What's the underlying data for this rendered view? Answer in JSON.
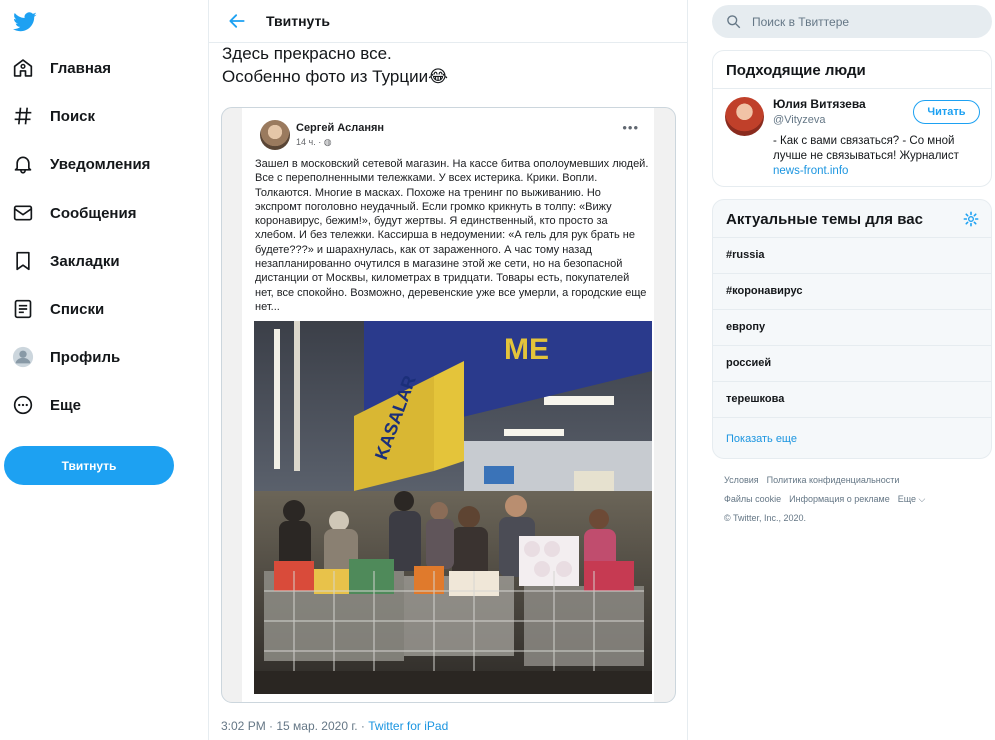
{
  "nav": {
    "items": [
      {
        "label": "Главная",
        "icon": "home-icon"
      },
      {
        "label": "Поиск",
        "icon": "hashtag-icon"
      },
      {
        "label": "Уведомления",
        "icon": "bell-icon"
      },
      {
        "label": "Сообщения",
        "icon": "mail-icon"
      },
      {
        "label": "Закладки",
        "icon": "bookmark-icon"
      },
      {
        "label": "Списки",
        "icon": "list-icon"
      },
      {
        "label": "Профиль",
        "icon": "profile-avatar"
      },
      {
        "label": "Еще",
        "icon": "more-icon"
      }
    ],
    "tweet_button": "Твитнуть"
  },
  "header": {
    "title": "Твитнуть"
  },
  "tweet": {
    "text_line1": "Здесь прекрасно все.",
    "text_line2": "Особенно фото из Турции",
    "emoji": "😂",
    "embedded_post": {
      "author": "Сергей Асланян",
      "time": "14 ч. ·",
      "body": "Зашел в московский сетевой магазин. На кассе битва ополоумевших людей. Все с переполненными тележками. У всех истерика. Крики. Вопли. Толкаются. Многие в масках. Похоже на тренинг по выживанию. Но экспромт поголовно неудачный. Если громко крикнуть в толпу: «Вижу коронавирус, бежим!», будут жертвы. Я единственный, кто просто за хлебом. И без тележки. Кассирша в недоумении: «А гель для рук брать не будете???» и шарахнулась, как от зараженного. А час тому назад незапланированно очутился в магазине этой же сети, но на безопасной дистанции от Москвы, километрах в тридцати. Товары есть, покупателей нет, все спокойно. Возможно, деревенские уже все умерли, а городские еще нет...",
      "photo_sign": "KASALAR",
      "photo_sign2": "ME"
    },
    "timestamp": "3:02 PM · 15 мар. 2020 г. · ",
    "source": "Twitter for iPad"
  },
  "search": {
    "placeholder": "Поиск в Твиттере"
  },
  "who_to_follow": {
    "title": "Подходящие люди",
    "person": {
      "name": "Юлия Витязева",
      "handle": "@Vityzeva",
      "bio": "- Как с вами связаться? - Со мной лучше не связываться! Журналист ",
      "link": "news-front.info",
      "follow_label": "Читать"
    }
  },
  "trends": {
    "title": "Актуальные темы для вас",
    "items": [
      "#russia",
      "#коронавирус",
      "европу",
      "россией",
      "терешкова"
    ],
    "show_more": "Показать еще"
  },
  "footer": {
    "line1": [
      "Условия",
      "Политика конфиденциальности"
    ],
    "line2": [
      "Файлы cookie",
      "Информация о рекламе",
      "Еще ⌵"
    ],
    "copyright": "© Twitter, Inc., 2020."
  },
  "colors": {
    "accent": "#1da1f2",
    "link": "#1b95e0",
    "muted": "#657786"
  }
}
